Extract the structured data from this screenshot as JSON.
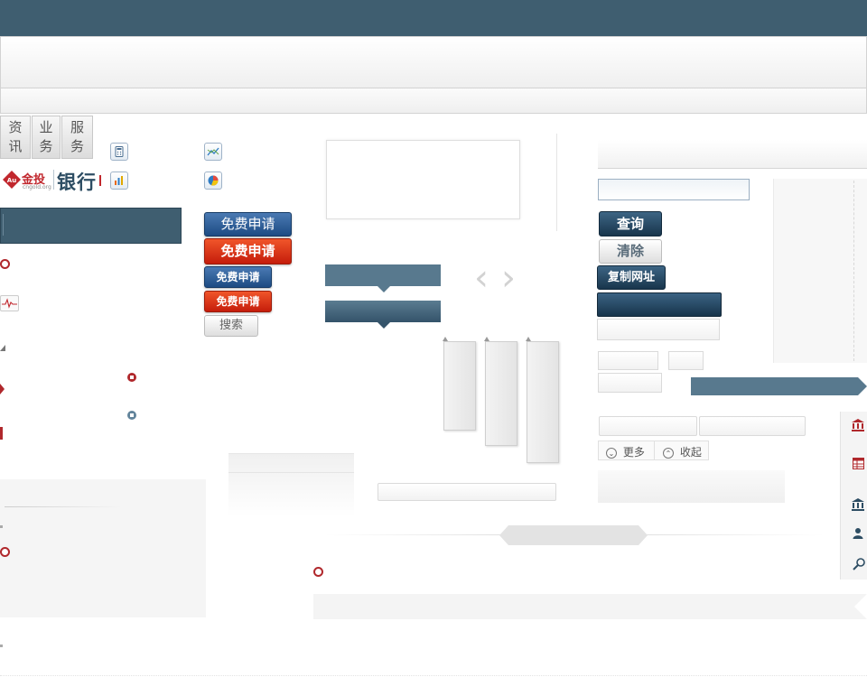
{
  "nav_tabs": [
    {
      "line1": "资",
      "line2": "讯"
    },
    {
      "line1": "业",
      "line2": "务"
    },
    {
      "line1": "服",
      "line2": "务"
    }
  ],
  "logo": {
    "brand": "金投",
    "domain": "cngold.org",
    "bank": "银行"
  },
  "buttons": {
    "apply_large_blue": "免费申请",
    "apply_large_red": "免费申请",
    "apply_small_blue": "免费申请",
    "apply_small_red": "免费申请",
    "search": "搜索",
    "query": "查询",
    "clear": "清除",
    "copy_url": "复制网址"
  },
  "toggles": {
    "more": "更多",
    "collapse": "收起"
  },
  "icons": {
    "calculator": "calculator-icon",
    "bar_chart": "bar-chart-icon",
    "line_chart": "line-chart-icon",
    "pie_chart": "pie-chart-icon",
    "pulse": "pulse-icon",
    "bank": "bank-icon",
    "table": "table-icon",
    "user": "user-icon",
    "search": "search-icon"
  },
  "colors": {
    "topbar": "#3f5e70",
    "accent_red": "#b0282c",
    "accent_blue": "#1d4b83"
  }
}
